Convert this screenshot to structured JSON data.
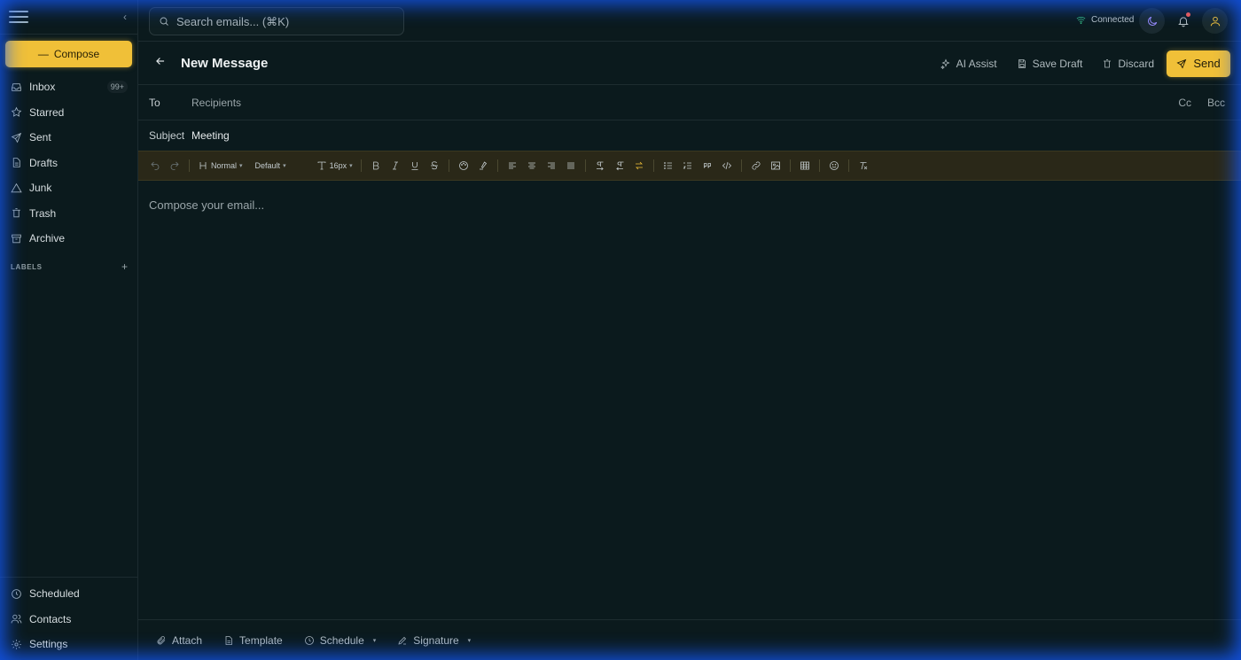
{
  "sidebar": {
    "compose_label": "Compose",
    "items": [
      {
        "label": "Inbox",
        "icon": "inbox-icon",
        "badge": "99+"
      },
      {
        "label": "Starred",
        "icon": "star-icon"
      },
      {
        "label": "Sent",
        "icon": "send-icon"
      },
      {
        "label": "Drafts",
        "icon": "file-icon"
      },
      {
        "label": "Junk",
        "icon": "warning-icon"
      },
      {
        "label": "Trash",
        "icon": "trash-icon"
      },
      {
        "label": "Archive",
        "icon": "archive-icon"
      }
    ],
    "labels_heading": "LABELS",
    "bottom_items": [
      {
        "label": "Scheduled",
        "icon": "clock-icon"
      },
      {
        "label": "Contacts",
        "icon": "users-icon"
      },
      {
        "label": "Settings",
        "icon": "gear-icon"
      }
    ]
  },
  "topbar": {
    "search_placeholder": "Search emails... (⌘K)",
    "status": "Connected"
  },
  "message": {
    "title": "New Message",
    "actions": {
      "ai_assist": "AI Assist",
      "save_draft": "Save Draft",
      "discard": "Discard",
      "send": "Send"
    },
    "to_label": "To",
    "to_placeholder": "Recipients",
    "cc": "Cc",
    "bcc": "Bcc",
    "subject_label": "Subject",
    "subject_value": "Meeting",
    "body_placeholder": "Compose your email..."
  },
  "toolbar": {
    "block_style": "Normal",
    "font": "Default",
    "font_size": "16px"
  },
  "footer": {
    "attach": "Attach",
    "template": "Template",
    "schedule": "Schedule",
    "signature": "Signature"
  },
  "colors": {
    "accent": "#f0c038",
    "background": "#0b1a1d",
    "toolbar": "#2a2818",
    "glow": "#145aff"
  }
}
